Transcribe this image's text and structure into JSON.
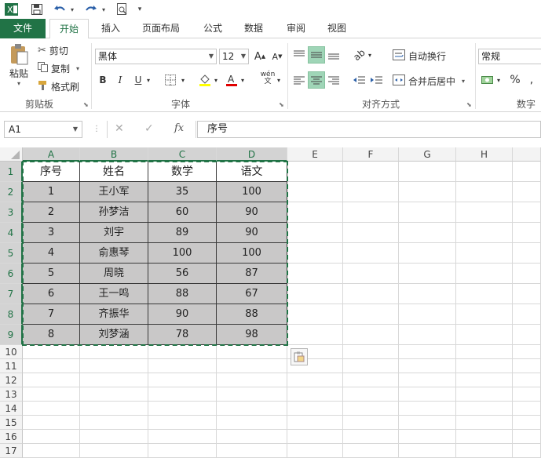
{
  "qat": {
    "app_icon": "excel-icon",
    "save_icon": "save-icon",
    "undo_icon": "undo-icon",
    "redo_icon": "redo-icon",
    "preview_icon": "print-preview-icon",
    "customize": "▾"
  },
  "tabs": [
    {
      "label": "文件"
    },
    {
      "label": "开始"
    },
    {
      "label": "插入"
    },
    {
      "label": "页面布局"
    },
    {
      "label": "公式"
    },
    {
      "label": "数据"
    },
    {
      "label": "审阅"
    },
    {
      "label": "视图"
    }
  ],
  "ribbon": {
    "clipboard": {
      "paste": "粘贴",
      "cut": "剪切",
      "copy": "复制",
      "format_painter": "格式刷",
      "group": "剪贴板"
    },
    "font": {
      "name": "黑体",
      "size": "12",
      "bold": "B",
      "italic": "I",
      "underline": "U",
      "phonetic": "wén",
      "group": "字体",
      "grow": "A",
      "shrink": "A"
    },
    "align": {
      "wrap": "自动换行",
      "merge": "合并后居中",
      "group": "对齐方式"
    },
    "number": {
      "format": "常规",
      "percent": "%",
      "group": "数字"
    }
  },
  "formula_bar": {
    "name_box": "A1",
    "cancel": "✕",
    "enter": "✓",
    "fx": "fx",
    "value": "序号"
  },
  "columns": [
    "A",
    "B",
    "C",
    "D",
    "E",
    "F",
    "G",
    "H"
  ],
  "rows": [
    "1",
    "2",
    "3",
    "4",
    "5",
    "6",
    "7",
    "8",
    "9",
    "10",
    "11",
    "12",
    "13",
    "14",
    "15",
    "16",
    "17"
  ],
  "table": {
    "headers": [
      "序号",
      "姓名",
      "数学",
      "语文"
    ],
    "rows": [
      [
        "1",
        "王小军",
        "35",
        "100"
      ],
      [
        "2",
        "孙梦洁",
        "60",
        "90"
      ],
      [
        "3",
        "刘宇",
        "89",
        "90"
      ],
      [
        "4",
        "俞惠琴",
        "100",
        "100"
      ],
      [
        "5",
        "周晓",
        "56",
        "87"
      ],
      [
        "6",
        "王一鸣",
        "88",
        "67"
      ],
      [
        "7",
        "齐振华",
        "90",
        "88"
      ],
      [
        "8",
        "刘梦涵",
        "78",
        "98"
      ]
    ]
  },
  "colors": {
    "excel_green": "#217346",
    "selection_fill": "#c9c8c8",
    "active_btn": "#9fd5b7"
  }
}
